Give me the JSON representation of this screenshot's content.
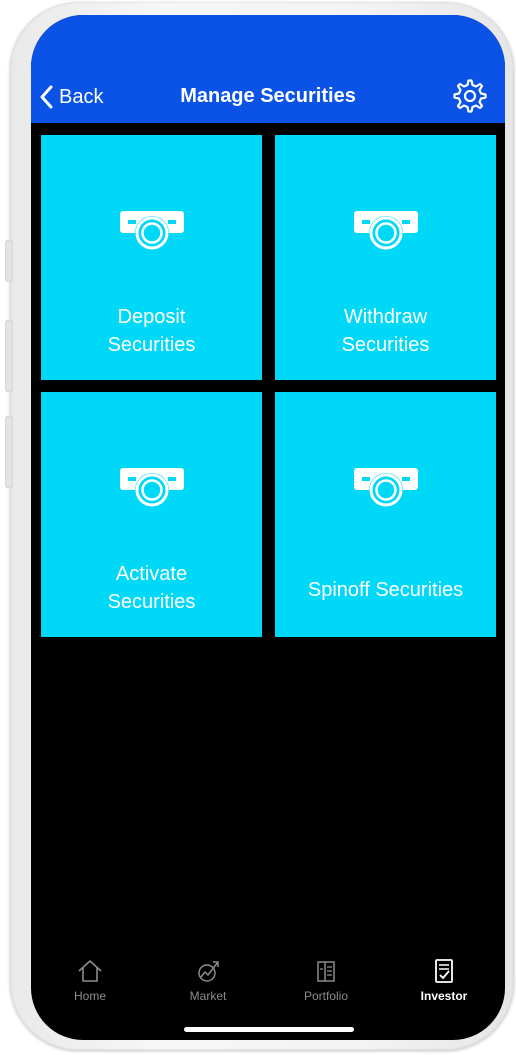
{
  "nav": {
    "back_label": "Back",
    "title": "Manage Securities",
    "settings_icon": "gear-icon"
  },
  "tiles": [
    {
      "line1": "Deposit",
      "line2": "Securities",
      "icon": "certificate-icon"
    },
    {
      "line1": "Withdraw",
      "line2": "Securities",
      "icon": "certificate-icon"
    },
    {
      "line1": "Activate",
      "line2": "Securities",
      "icon": "certificate-icon"
    },
    {
      "line1": "Spinoff Securities",
      "icon": "certificate-icon"
    }
  ],
  "tab_bar": {
    "items": [
      {
        "label": "Home",
        "icon": "home-icon",
        "active": false
      },
      {
        "label": "Market",
        "icon": "market-chart-icon",
        "active": false
      },
      {
        "label": "Portfolio",
        "icon": "portfolio-icon",
        "active": false
      },
      {
        "label": "Investor",
        "icon": "investor-icon",
        "active": true
      }
    ]
  },
  "colors": {
    "nav_background": "#0a53e6",
    "tile_background": "#00d8f7",
    "screen_background": "#000000",
    "tab_inactive": "#8c8c8c",
    "tab_active": "#ffffff"
  }
}
